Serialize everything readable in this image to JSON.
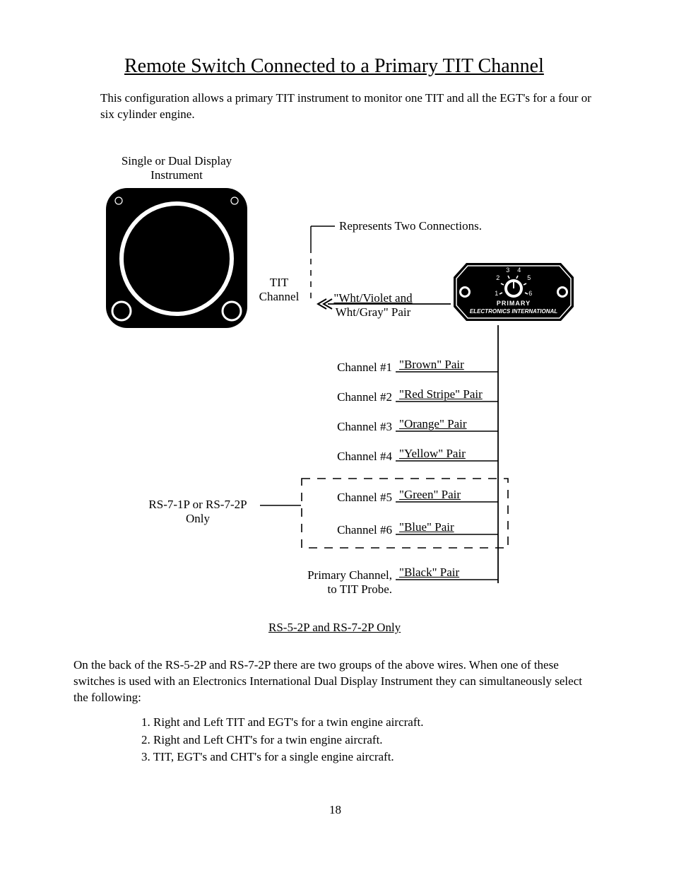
{
  "title": "Remote Switch Connected to a Primary TIT Channel",
  "intro": "This configuration allows a primary TIT instrument to monitor one TIT and all the EGT's for a four or six cylinder engine.",
  "diagram": {
    "instrument_label_line1": "Single or Dual Display",
    "instrument_label_line2": "Instrument",
    "tit_channel_line1": "TIT",
    "tit_channel_line2": "Channel",
    "two_conn": "Represents Two Connections.",
    "tit_pair_line1": "\"Wht/Violet and",
    "tit_pair_line2": "Wht/Gray\" Pair",
    "rs7_line1": "RS-7-1P or RS-7-2P",
    "rs7_line2": "Only",
    "primary_badge_top": "PRIMARY",
    "primary_badge_bottom": "ELECTRONICS INTERNATIONAL",
    "dial_nums": {
      "n1": "1",
      "n2": "2",
      "n3": "3",
      "n4": "4",
      "n5": "5",
      "n6": "6"
    },
    "channels": [
      {
        "label": "Channel #1",
        "pair": "\"Brown\" Pair"
      },
      {
        "label": "Channel #2",
        "pair": "\"Red Stripe\" Pair"
      },
      {
        "label": "Channel #3",
        "pair": "\"Orange\" Pair"
      },
      {
        "label": "Channel #4",
        "pair": "\"Yellow\" Pair"
      },
      {
        "label": "Channel #5",
        "pair": "\"Green\" Pair"
      },
      {
        "label": "Channel #6",
        "pair": "\"Blue\" Pair"
      }
    ],
    "primary_channel_line1": "Primary Channel,",
    "primary_channel_line2": "to TIT Probe.",
    "primary_pair": "\"Black\" Pair"
  },
  "section2": {
    "heading": "RS-5-2P and RS-7-2P Only",
    "body": "On the back of the RS-5-2P and RS-7-2P there are two groups of the above wires.  When one of these switches is used with an Electronics International Dual Display Instrument they can simultaneously select the following:",
    "items": [
      "1.  Right and Left TIT and EGT's for a twin engine aircraft.",
      "2.  Right and Left CHT's for a twin engine aircraft.",
      "3.  TIT, EGT's and CHT's for a single engine aircraft."
    ]
  },
  "page_number": "18"
}
